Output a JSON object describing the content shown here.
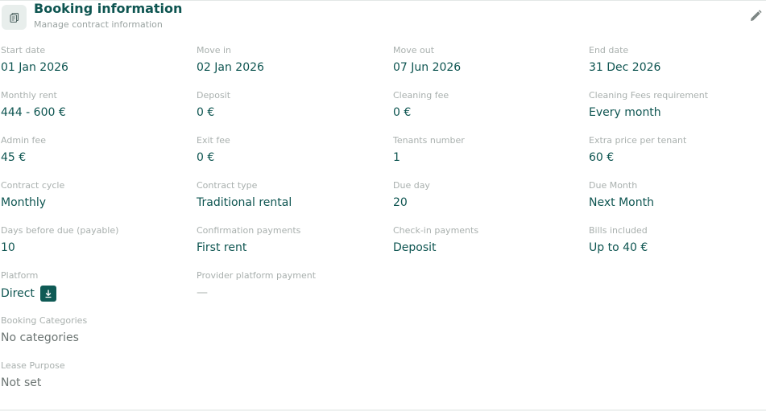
{
  "header": {
    "title": "Booking information",
    "subtitle": "Manage contract information",
    "icon": "document-copy-icon",
    "edit_icon": "pencil-icon"
  },
  "colors": {
    "accent": "#0e5551",
    "label": "#a9b0ae",
    "muted": "#6b7472"
  },
  "fields": {
    "start_date": {
      "label": "Start date",
      "value": "01 Jan 2026"
    },
    "move_in": {
      "label": "Move in",
      "value": "02 Jan 2026"
    },
    "move_out": {
      "label": "Move out",
      "value": "07 Jun 2026"
    },
    "end_date": {
      "label": "End date",
      "value": "31 Dec 2026"
    },
    "monthly_rent": {
      "label": "Monthly rent",
      "value": "444 - 600 €"
    },
    "deposit": {
      "label": "Deposit",
      "value": "0 €"
    },
    "cleaning_fee": {
      "label": "Cleaning fee",
      "value": "0 €"
    },
    "cleaning_fees_requirement": {
      "label": "Cleaning Fees requirement",
      "value": "Every month"
    },
    "admin_fee": {
      "label": "Admin fee",
      "value": "45 €"
    },
    "exit_fee": {
      "label": "Exit fee",
      "value": "0 €"
    },
    "tenants_number": {
      "label": "Tenants number",
      "value": "1"
    },
    "extra_price_per_tenant": {
      "label": "Extra price per tenant",
      "value": "60 €"
    },
    "contract_cycle": {
      "label": "Contract cycle",
      "value": "Monthly"
    },
    "contract_type": {
      "label": "Contract type",
      "value": "Traditional rental"
    },
    "due_day": {
      "label": "Due day",
      "value": "20"
    },
    "due_month": {
      "label": "Due Month",
      "value": "Next Month"
    },
    "days_before_due": {
      "label": "Days before due (payable)",
      "value": "10"
    },
    "confirmation_payments": {
      "label": "Confirmation payments",
      "value": "First rent"
    },
    "checkin_payments": {
      "label": "Check-in payments",
      "value": "Deposit"
    },
    "bills_included": {
      "label": "Bills included",
      "value": "Up to 40 €"
    },
    "platform": {
      "label": "Platform",
      "value": "Direct",
      "badge_icon": "arrow-down-in-box-icon"
    },
    "provider_platform_payment": {
      "label": "Provider platform payment",
      "value": "—"
    },
    "booking_categories": {
      "label": "Booking Categories",
      "value": "No categories"
    },
    "lease_purpose": {
      "label": "Lease Purpose",
      "value": "Not set"
    }
  }
}
